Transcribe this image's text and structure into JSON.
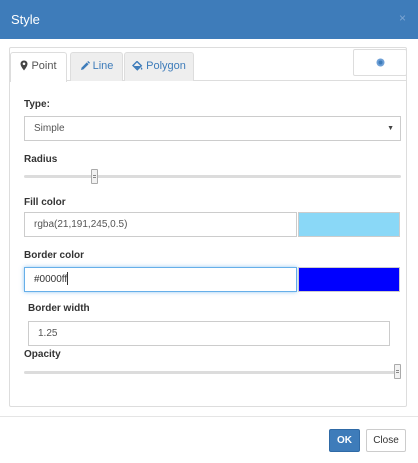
{
  "dialog": {
    "title": "Style",
    "close_glyph": "×"
  },
  "tabs": [
    {
      "label": "Point",
      "icon": "map-marker-icon",
      "active": true
    },
    {
      "label": "Line",
      "icon": "pencil-icon",
      "active": false
    },
    {
      "label": "Polygon",
      "icon": "paint-bucket-icon",
      "active": false
    }
  ],
  "extra_tab": {
    "icon": "circle-dot-icon"
  },
  "form": {
    "type": {
      "label": "Type:",
      "value": "Simple",
      "arrow": "▼"
    },
    "radius": {
      "label": "Radius",
      "slider_fraction": 0.18
    },
    "fill_color": {
      "label": "Fill color",
      "value": "rgba(21,191,245,0.5)",
      "swatch": "#8ad8f7"
    },
    "border_color": {
      "label": "Border color",
      "value": "#0000ff",
      "swatch": "#0000ff"
    },
    "border_width": {
      "label": "Border width",
      "value": "1.25"
    },
    "opacity": {
      "label": "Opacity",
      "slider_fraction": 1.0
    }
  },
  "footer": {
    "ok_label": "OK",
    "close_label": "Close"
  },
  "colors": {
    "accent": "#3e7cba",
    "focus": "#66afe9"
  }
}
